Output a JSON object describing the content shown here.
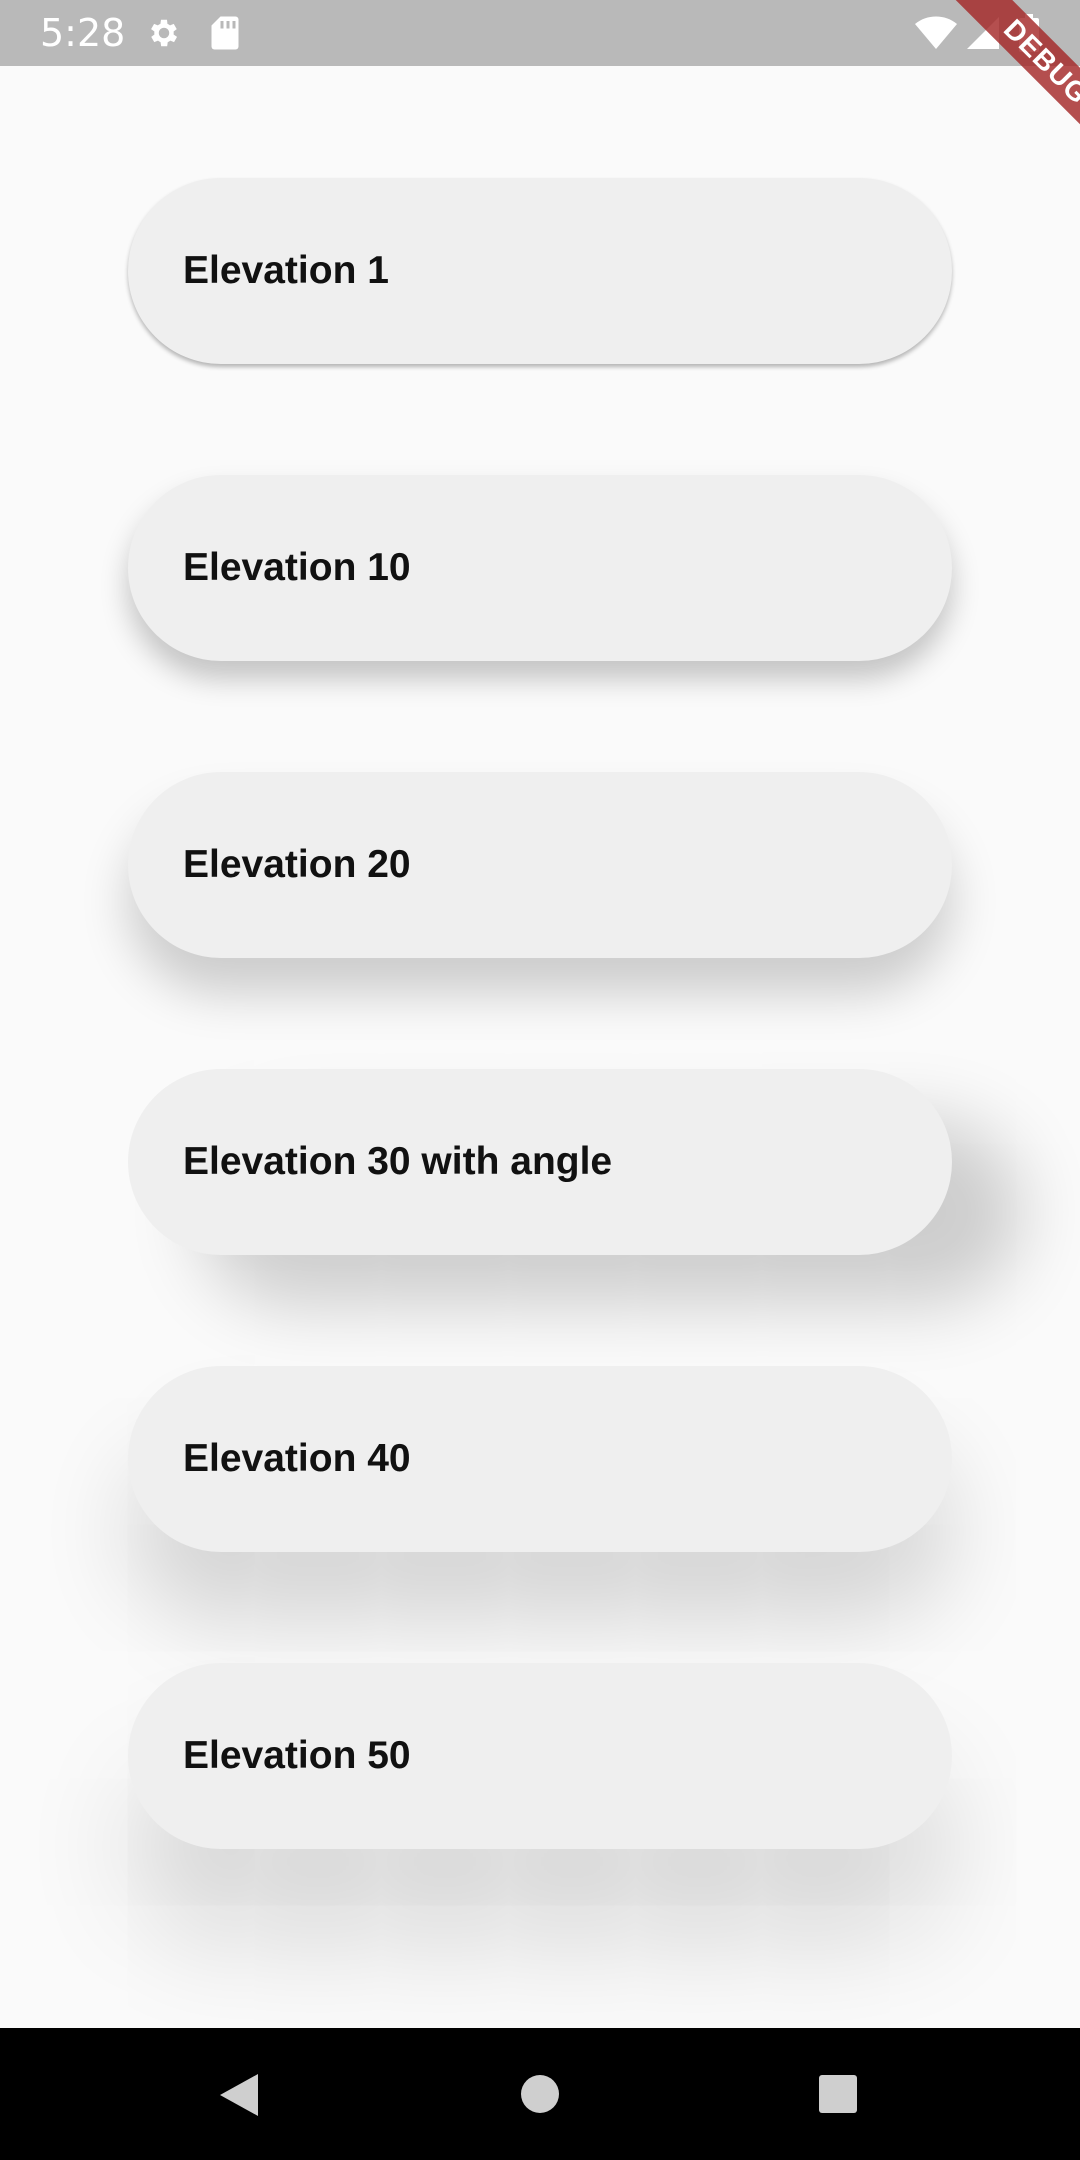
{
  "status_bar": {
    "time": "5:28",
    "icons": [
      "settings-gear-icon",
      "sd-card-icon",
      "wifi-icon",
      "cell-signal-icon",
      "battery-icon"
    ]
  },
  "debug_banner": {
    "label": "DEBUG",
    "color": "#a52828"
  },
  "cards": [
    {
      "label": "Elevation 1"
    },
    {
      "label": "Elevation 10"
    },
    {
      "label": "Elevation 20"
    },
    {
      "label": "Elevation 30 with angle"
    },
    {
      "label": "Elevation 40"
    },
    {
      "label": "Elevation 50"
    }
  ],
  "nav_bar": {
    "icons": [
      "back-icon",
      "home-icon",
      "recents-icon"
    ]
  },
  "colors": {
    "background": "#fafafa",
    "card": "#efefef",
    "status_bar": "#b9b9b9",
    "nav_bar": "#000000"
  }
}
